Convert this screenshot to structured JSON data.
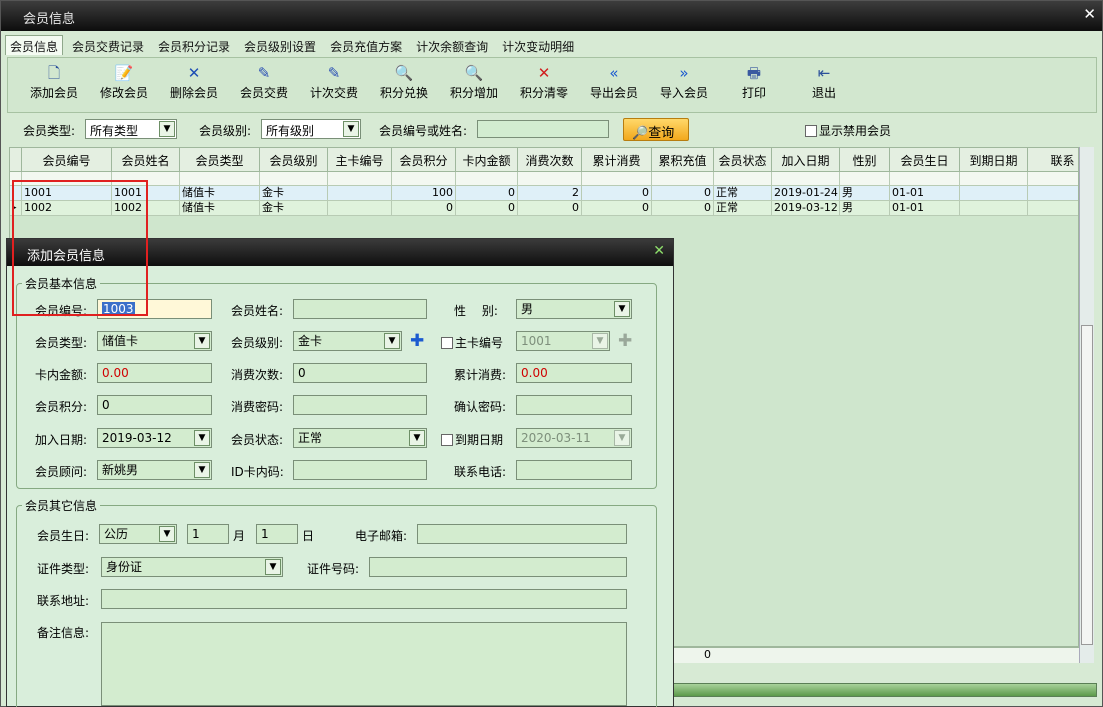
{
  "window": {
    "title": "会员信息",
    "close_icon": "✕"
  },
  "tabs": [
    "会员信息",
    "会员交费记录",
    "会员积分记录",
    "会员级别设置",
    "会员充值方案",
    "计次余额查询",
    "计次变动明细"
  ],
  "toolbar": [
    {
      "label": "添加会员",
      "icon": "page-icon",
      "glyph": "🗋",
      "color": "#2a4f9a"
    },
    {
      "label": "修改会员",
      "icon": "edit-page-icon",
      "glyph": "📝",
      "color": "#b07a10"
    },
    {
      "label": "删除会员",
      "icon": "delete-x-icon",
      "glyph": "✕",
      "color": "#1f4fb5"
    },
    {
      "label": "会员交费",
      "icon": "pen-icon",
      "glyph": "✎",
      "color": "#2a4fb5"
    },
    {
      "label": "计次交费",
      "icon": "pen-icon",
      "glyph": "✎",
      "color": "#2a4fb5"
    },
    {
      "label": "积分兑换",
      "icon": "zoom-out-icon",
      "glyph": "🔍",
      "color": "#8b2a2a"
    },
    {
      "label": "积分增加",
      "icon": "zoom-in-icon",
      "glyph": "🔍",
      "color": "#2a6b2a"
    },
    {
      "label": "积分清零",
      "icon": "clear-x-icon",
      "glyph": "✕",
      "color": "#d02020"
    },
    {
      "label": "导出会员",
      "icon": "double-left-arrow-icon",
      "glyph": "«",
      "color": "#1c5bd0"
    },
    {
      "label": "导入会员",
      "icon": "double-right-arrow-icon",
      "glyph": "»",
      "color": "#1c5bd0"
    },
    {
      "label": "打印",
      "icon": "printer-icon",
      "glyph": "🖶",
      "color": "#3a5aa0"
    },
    {
      "label": "退出",
      "icon": "exit-door-icon",
      "glyph": "⇤",
      "color": "#2a4f9a"
    }
  ],
  "filter": {
    "type_label": "会员类型:",
    "type_value": "所有类型",
    "level_label": "会员级别:",
    "level_value": "所有级别",
    "search_label": "会员编号或姓名:",
    "search_value": "",
    "query_label": "查询",
    "show_disabled_label": "显示禁用会员"
  },
  "grid": {
    "columns": [
      "会员编号",
      "会员姓名",
      "会员类型",
      "会员级别",
      "主卡编号",
      "会员积分",
      "卡内金额",
      "消费次数",
      "累计消费",
      "累积充值",
      "会员状态",
      "加入日期",
      "性别",
      "会员生日",
      "到期日期",
      "联系"
    ],
    "rows": [
      [
        "1001",
        "1001",
        "储值卡",
        "金卡",
        "",
        "100",
        "0",
        "2",
        "0",
        "0",
        "正常",
        "2019-01-24",
        "男",
        "01-01",
        "",
        ""
      ],
      [
        "1002",
        "1002",
        "储值卡",
        "金卡",
        "",
        "0",
        "0",
        "0",
        "0",
        "0",
        "正常",
        "2019-03-12",
        "男",
        "01-01",
        "",
        ""
      ]
    ],
    "summary_value": "0"
  },
  "dialog": {
    "title": "添加会员信息",
    "close_icon": "✕",
    "basic_group": "会员基本信息",
    "other_group": "会员其它信息",
    "fields": {
      "member_no_label": "会员编号:",
      "member_no_value": "1003",
      "member_name_label": "会员姓名:",
      "member_name_value": "",
      "gender_label": "性　 别:",
      "gender_value": "男",
      "type_label": "会员类型:",
      "type_value": "储值卡",
      "level_label": "会员级别:",
      "level_value": "金卡",
      "main_card_label": "主卡编号",
      "main_card_value": "1001",
      "balance_label": "卡内金额:",
      "balance_value": "0.00",
      "count_label": "消费次数:",
      "count_value": "0",
      "total_label": "累计消费:",
      "total_value": "0.00",
      "points_label": "会员积分:",
      "points_value": "0",
      "pwd_label": "消费密码:",
      "pwd_value": "",
      "confirm_label": "确认密码:",
      "confirm_value": "",
      "join_label": "加入日期:",
      "join_value": "2019-03-12",
      "status_label": "会员状态:",
      "status_value": "正常",
      "expire_label": "到期日期",
      "expire_value": "2020-03-11",
      "advisor_label": "会员顾问:",
      "advisor_value": "新姚男",
      "id_label": "ID卡内码:",
      "id_value": "",
      "phone_label": "联系电话:",
      "phone_value": "",
      "birthday_label": "会员生日:",
      "calendar_value": "公历",
      "month_value": "1",
      "month_label": "月",
      "day_value": "1",
      "day_label": "日",
      "email_label": "电子邮箱:",
      "email_value": "",
      "cert_label": "证件类型:",
      "cert_value": "身份证",
      "cert_no_label": "证件号码:",
      "cert_no_value": "",
      "address_label": "联系地址:",
      "address_value": "",
      "note_label": "备注信息:",
      "note_value": ""
    }
  }
}
